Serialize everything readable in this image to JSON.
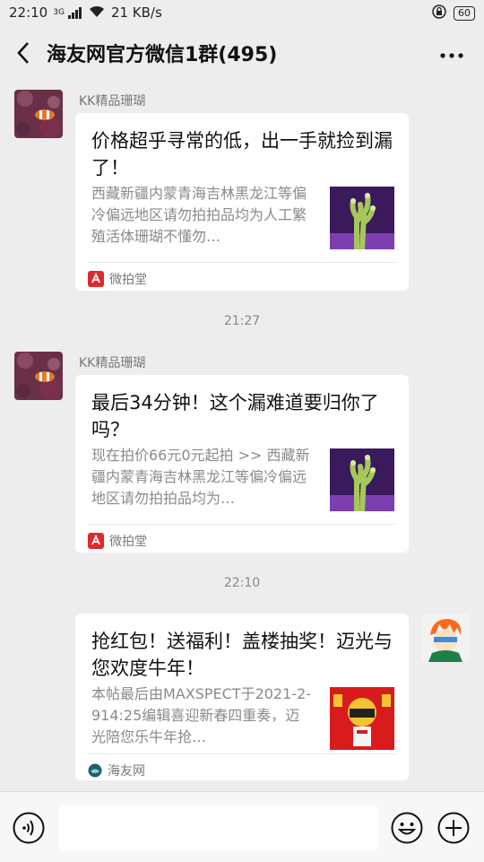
{
  "status_bar": {
    "time": "22:10",
    "network": "3G",
    "speed": "21 KB/s",
    "battery": "60"
  },
  "header": {
    "title": "海友网官方微信1群(495)"
  },
  "messages": [
    {
      "sender": "KK精品珊瑚",
      "title": "价格超乎寻常的低，出一手就捡到漏了！",
      "desc": "西藏新疆内蒙青海吉林黑龙江等偏冷偏远地区请勿拍拍品均为人工繁殖活体珊瑚不懂勿…",
      "source": "微拍堂"
    },
    {
      "sender": "KK精品珊瑚",
      "title": "最后34分钟！这个漏难道要归你了吗？",
      "desc": "现在拍价66元0元起拍 >> 西藏新疆内蒙青海吉林黑龙江等偏冷偏远地区请勿拍拍品均为…",
      "source": "微拍堂"
    },
    {
      "title": "抢红包！送福利！盖楼抽奖！迈光与您欢度牛年！",
      "desc": "本帖最后由MAXSPECT于2021-2-914:25编辑喜迎新春四重奏，迈光陪您乐牛年抢…",
      "source": "海友网"
    }
  ],
  "timestamps": [
    "21:27",
    "22:10"
  ],
  "colors": {
    "background": "#ededed",
    "card": "#ffffff",
    "weipaitang_red": "#e0292b",
    "haiyou_teal": "#1f5f6e"
  }
}
